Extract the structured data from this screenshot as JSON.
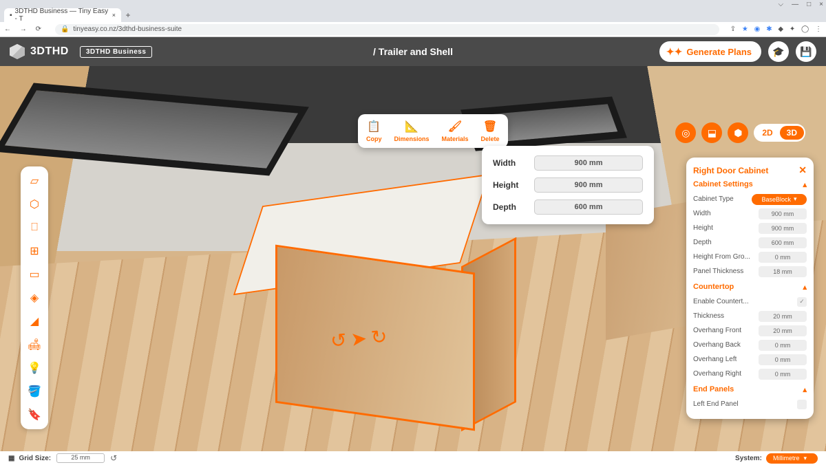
{
  "browser": {
    "tab_title": "3DTHD Business — Tiny Easy - T",
    "url_lock": "🔒",
    "url": "tinyeasy.co.nz/3dthd-business-suite",
    "controls": {
      "min": "—",
      "max": "□",
      "close": "×",
      "menu": "⋮"
    }
  },
  "header": {
    "logo_text": "3DTHD",
    "badge": "3DTHD Business",
    "breadcrumb": "/ Trailer and Shell",
    "generate": "Generate Plans"
  },
  "left_tools": [
    "▱",
    "⬡",
    "⎕",
    "⊞",
    "▭",
    "◈",
    "◢",
    "🛋",
    "💡",
    "🪣",
    "🔖"
  ],
  "action_bar": [
    {
      "icon": "📋",
      "label": "Copy"
    },
    {
      "icon": "📐",
      "label": "Dimensions"
    },
    {
      "icon": "🖌",
      "label": "Materials"
    },
    {
      "icon": "🗑",
      "label": "Delete"
    }
  ],
  "dims": {
    "rows": [
      {
        "label": "Width",
        "value": "900 mm"
      },
      {
        "label": "Height",
        "value": "900 mm"
      },
      {
        "label": "Depth",
        "value": "600 mm"
      }
    ]
  },
  "view": {
    "two": "2D",
    "three": "3D"
  },
  "panel": {
    "title": "Right Door Cabinet",
    "sections": [
      {
        "title": "Cabinet Settings",
        "rows": [
          {
            "label": "Cabinet Type",
            "type": "select",
            "value": "BaseBlock"
          },
          {
            "label": "Width",
            "type": "input",
            "value": "900 mm"
          },
          {
            "label": "Height",
            "type": "input",
            "value": "900 mm"
          },
          {
            "label": "Depth",
            "type": "input",
            "value": "600 mm"
          },
          {
            "label": "Height From Gro...",
            "type": "input",
            "value": "0 mm"
          },
          {
            "label": "Panel Thickness",
            "type": "input",
            "value": "18 mm"
          }
        ]
      },
      {
        "title": "Countertop",
        "rows": [
          {
            "label": "Enable Countert...",
            "type": "check",
            "value": "✓"
          },
          {
            "label": "Thickness",
            "type": "input",
            "value": "20 mm"
          },
          {
            "label": "Overhang Front",
            "type": "input",
            "value": "20 mm"
          },
          {
            "label": "Overhang Back",
            "type": "input",
            "value": "0 mm"
          },
          {
            "label": "Overhang Left",
            "type": "input",
            "value": "0 mm"
          },
          {
            "label": "Overhang Right",
            "type": "input",
            "value": "0 mm"
          }
        ]
      },
      {
        "title": "End Panels",
        "rows": [
          {
            "label": "Left End Panel",
            "type": "check",
            "value": ""
          }
        ]
      }
    ]
  },
  "bottom": {
    "grid_label": "Grid Size:",
    "grid_value": "25 mm",
    "system_label": "System:",
    "system_value": "Millimetre"
  }
}
